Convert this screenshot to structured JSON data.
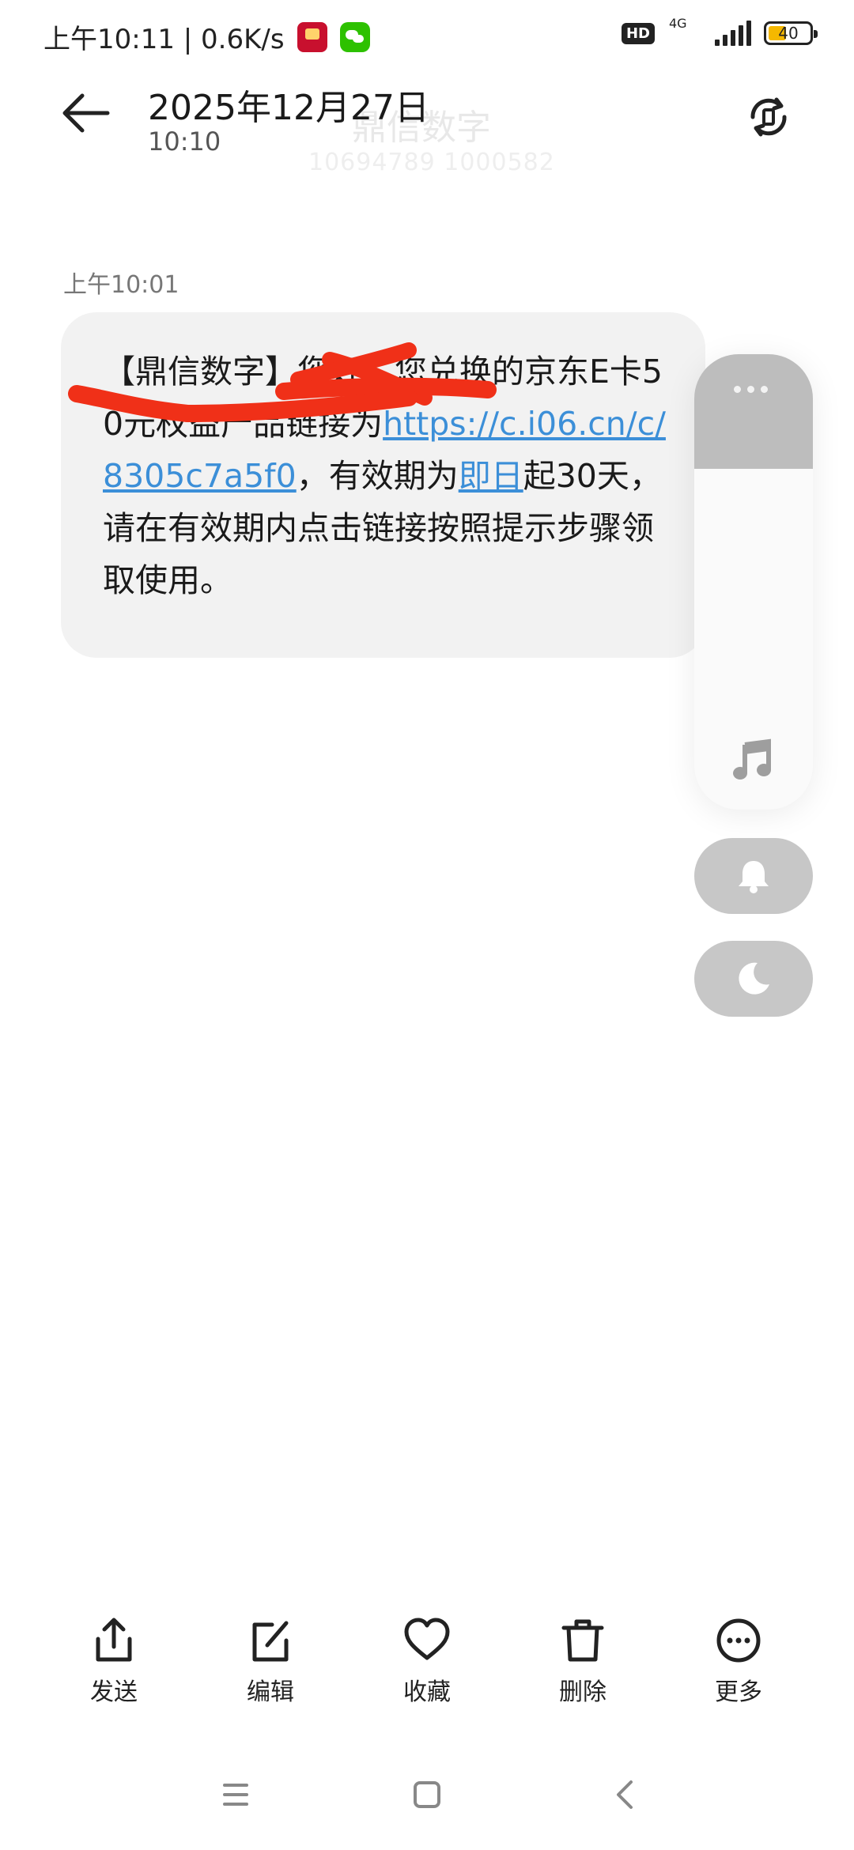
{
  "status_bar": {
    "time_speed": "上午10:11 | 0.6K/s",
    "hd": "HD",
    "network": "4G",
    "battery": "40"
  },
  "header": {
    "date": "2025年12月27日",
    "time": "10:10",
    "sender_name": "鼎信数字",
    "sender_number": "10694789 1000582"
  },
  "message": {
    "timestamp": "上午10:01",
    "text_before_link": "【鼎信数字】您好，您兑换的京东E卡50元权益产品链接为",
    "link": "https://c.i06.cn/c/8305c7a5f0",
    "text_middle": "，有效期为",
    "date_link": "即日",
    "text_after": "起30天，请在有效期内点击链接按照提示步骤领取使用。"
  },
  "side_panel": {
    "icons": [
      "more-dots-icon",
      "music-note-icon",
      "bell-icon",
      "moon-icon"
    ]
  },
  "toolbar": {
    "send": "发送",
    "edit": "编辑",
    "favorite": "收藏",
    "delete": "删除",
    "more": "更多"
  },
  "colors": {
    "link": "#3c8fd8",
    "bubble": "#f2f2f2",
    "redaction": "#f03018",
    "panel_grey": "#bdbdbd"
  }
}
